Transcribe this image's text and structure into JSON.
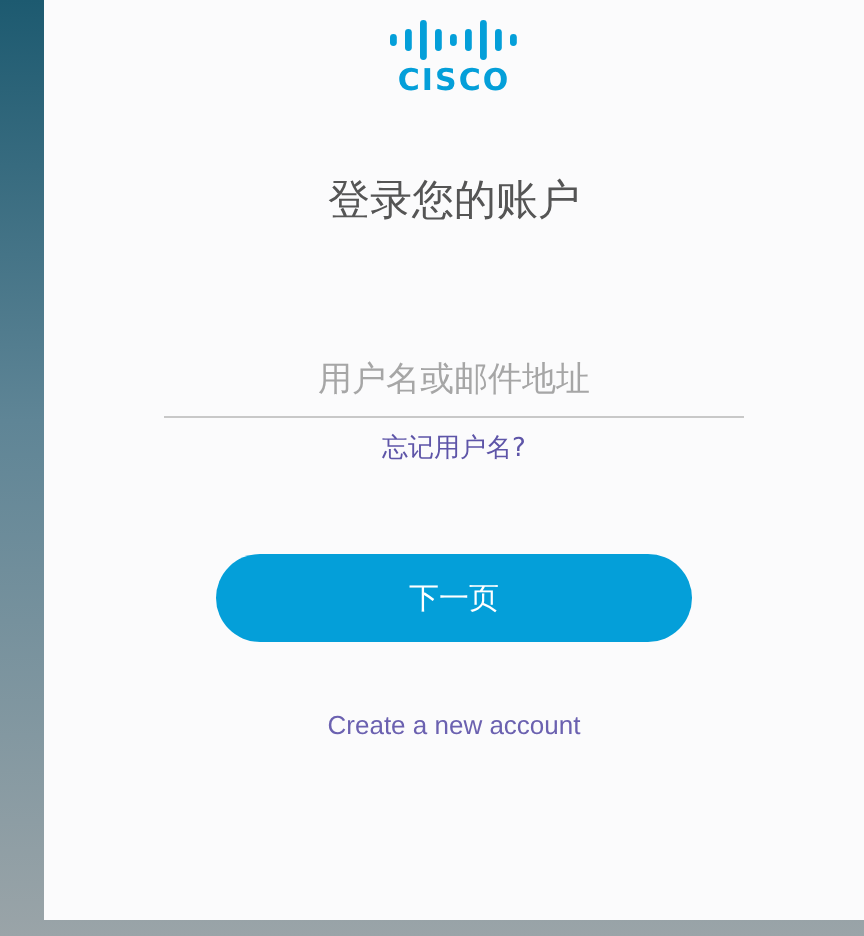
{
  "logo": {
    "text": "CISCO"
  },
  "title": "登录您的账户",
  "username_field": {
    "placeholder": "用户名或邮件地址"
  },
  "forgot_link": "忘记用户名?",
  "next_button": "下一页",
  "create_account_link": "Create a new account"
}
